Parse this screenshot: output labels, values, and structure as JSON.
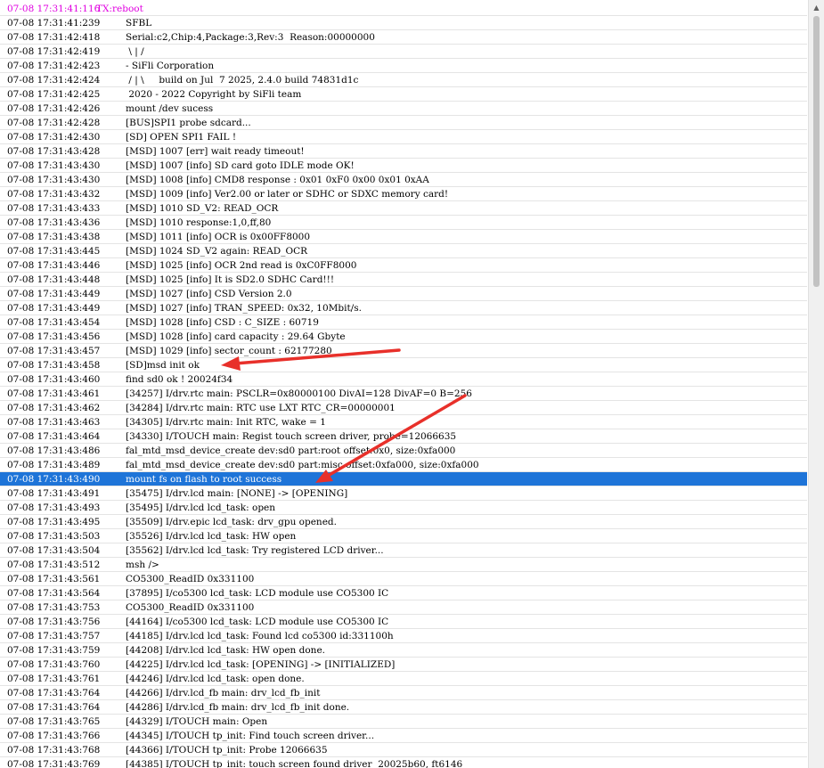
{
  "colors": {
    "tx_line": "#e000e0",
    "selected_bg": "#1e74d8",
    "selected_text": "#ffffff",
    "annotation_arrow": "#e8302a"
  },
  "log": {
    "selected_index": 33,
    "rows": [
      {
        "ts": "07-08 17:31:41:116",
        "msg": "TX:reboot",
        "kind": "tx"
      },
      {
        "ts": "07-08 17:31:41:239",
        "msg": "SFBL"
      },
      {
        "ts": "07-08 17:31:42:418",
        "msg": "Serial:c2,Chip:4,Package:3,Rev:3  Reason:00000000"
      },
      {
        "ts": "07-08 17:31:42:419",
        "msg": " \\ | /"
      },
      {
        "ts": "07-08 17:31:42:423",
        "msg": "- SiFli Corporation"
      },
      {
        "ts": "07-08 17:31:42:424",
        "msg": " / | \\     build on Jul  7 2025, 2.4.0 build 74831d1c"
      },
      {
        "ts": "07-08 17:31:42:425",
        "msg": " 2020 - 2022 Copyright by SiFli team"
      },
      {
        "ts": "07-08 17:31:42:426",
        "msg": "mount /dev sucess"
      },
      {
        "ts": "07-08 17:31:42:428",
        "msg": "[BUS]SPI1 probe sdcard..."
      },
      {
        "ts": "07-08 17:31:42:430",
        "msg": "[SD] OPEN SPI1 FAIL !"
      },
      {
        "ts": "07-08 17:31:43:428",
        "msg": "[MSD] 1007 [err] wait ready timeout!"
      },
      {
        "ts": "07-08 17:31:43:430",
        "msg": "[MSD] 1007 [info] SD card goto IDLE mode OK!"
      },
      {
        "ts": "07-08 17:31:43:430",
        "msg": "[MSD] 1008 [info] CMD8 response : 0x01 0xF0 0x00 0x01 0xAA"
      },
      {
        "ts": "07-08 17:31:43:432",
        "msg": "[MSD] 1009 [info] Ver2.00 or later or SDHC or SDXC memory card!"
      },
      {
        "ts": "07-08 17:31:43:433",
        "msg": "[MSD] 1010 SD_V2: READ_OCR"
      },
      {
        "ts": "07-08 17:31:43:436",
        "msg": "[MSD] 1010 response:1,0,ff,80"
      },
      {
        "ts": "07-08 17:31:43:438",
        "msg": "[MSD] 1011 [info] OCR is 0x00FF8000"
      },
      {
        "ts": "07-08 17:31:43:445",
        "msg": "[MSD] 1024 SD_V2 again: READ_OCR"
      },
      {
        "ts": "07-08 17:31:43:446",
        "msg": "[MSD] 1025 [info] OCR 2nd read is 0xC0FF8000"
      },
      {
        "ts": "07-08 17:31:43:448",
        "msg": "[MSD] 1025 [info] It is SD2.0 SDHC Card!!!"
      },
      {
        "ts": "07-08 17:31:43:449",
        "msg": "[MSD] 1027 [info] CSD Version 2.0"
      },
      {
        "ts": "07-08 17:31:43:449",
        "msg": "[MSD] 1027 [info] TRAN_SPEED: 0x32, 10Mbit/s."
      },
      {
        "ts": "07-08 17:31:43:454",
        "msg": "[MSD] 1028 [info] CSD : C_SIZE : 60719"
      },
      {
        "ts": "07-08 17:31:43:456",
        "msg": "[MSD] 1028 [info] card capacity : 29.64 Gbyte"
      },
      {
        "ts": "07-08 17:31:43:457",
        "msg": "[MSD] 1029 [info] sector_count : 62177280"
      },
      {
        "ts": "07-08 17:31:43:458",
        "msg": "[SD]msd init ok"
      },
      {
        "ts": "07-08 17:31:43:460",
        "msg": "find sd0 ok ! 20024f34"
      },
      {
        "ts": "07-08 17:31:43:461",
        "msg": "[34257] I/drv.rtc main: PSCLR=0x80000100 DivAI=128 DivAF=0 B=256"
      },
      {
        "ts": "07-08 17:31:43:462",
        "msg": "[34284] I/drv.rtc main: RTC use LXT RTC_CR=00000001"
      },
      {
        "ts": "07-08 17:31:43:463",
        "msg": "[34305] I/drv.rtc main: Init RTC, wake = 1"
      },
      {
        "ts": "07-08 17:31:43:464",
        "msg": "[34330] I/TOUCH main: Regist touch screen driver, probe=12066635"
      },
      {
        "ts": "07-08 17:31:43:486",
        "msg": "fal_mtd_msd_device_create dev:sd0 part:root offset:0x0, size:0xfa000"
      },
      {
        "ts": "07-08 17:31:43:489",
        "msg": "fal_mtd_msd_device_create dev:sd0 part:misc offset:0xfa000, size:0xfa000"
      },
      {
        "ts": "07-08 17:31:43:490",
        "msg": "mount fs on flash to root success"
      },
      {
        "ts": "07-08 17:31:43:491",
        "msg": "[35475] I/drv.lcd main: [NONE] -> [OPENING]"
      },
      {
        "ts": "07-08 17:31:43:493",
        "msg": "[35495] I/drv.lcd lcd_task: open"
      },
      {
        "ts": "07-08 17:31:43:495",
        "msg": "[35509] I/drv.epic lcd_task: drv_gpu opened."
      },
      {
        "ts": "07-08 17:31:43:503",
        "msg": "[35526] I/drv.lcd lcd_task: HW open"
      },
      {
        "ts": "07-08 17:31:43:504",
        "msg": "[35562] I/drv.lcd lcd_task: Try registered LCD driver..."
      },
      {
        "ts": "07-08 17:31:43:512",
        "msg": "msh />"
      },
      {
        "ts": "07-08 17:31:43:561",
        "msg": "CO5300_ReadID 0x331100"
      },
      {
        "ts": "07-08 17:31:43:564",
        "msg": "[37895] I/co5300 lcd_task: LCD module use CO5300 IC"
      },
      {
        "ts": "07-08 17:31:43:753",
        "msg": "CO5300_ReadID 0x331100"
      },
      {
        "ts": "07-08 17:31:43:756",
        "msg": "[44164] I/co5300 lcd_task: LCD module use CO5300 IC"
      },
      {
        "ts": "07-08 17:31:43:757",
        "msg": "[44185] I/drv.lcd lcd_task: Found lcd co5300 id:331100h"
      },
      {
        "ts": "07-08 17:31:43:759",
        "msg": "[44208] I/drv.lcd lcd_task: HW open done."
      },
      {
        "ts": "07-08 17:31:43:760",
        "msg": "[44225] I/drv.lcd lcd_task: [OPENING] -> [INITIALIZED]"
      },
      {
        "ts": "07-08 17:31:43:761",
        "msg": "[44246] I/drv.lcd lcd_task: open done."
      },
      {
        "ts": "07-08 17:31:43:764",
        "msg": "[44266] I/drv.lcd_fb main: drv_lcd_fb_init"
      },
      {
        "ts": "07-08 17:31:43:764",
        "msg": "[44286] I/drv.lcd_fb main: drv_lcd_fb_init done."
      },
      {
        "ts": "07-08 17:31:43:765",
        "msg": "[44329] I/TOUCH main: Open"
      },
      {
        "ts": "07-08 17:31:43:766",
        "msg": "[44345] I/TOUCH tp_init: Find touch screen driver..."
      },
      {
        "ts": "07-08 17:31:43:768",
        "msg": "[44366] I/TOUCH tp_init: Probe 12066635"
      },
      {
        "ts": "07-08 17:31:43:769",
        "msg": "[44385] I/TOUCH tp_init: touch screen found driver  20025b60, ft6146"
      }
    ]
  }
}
